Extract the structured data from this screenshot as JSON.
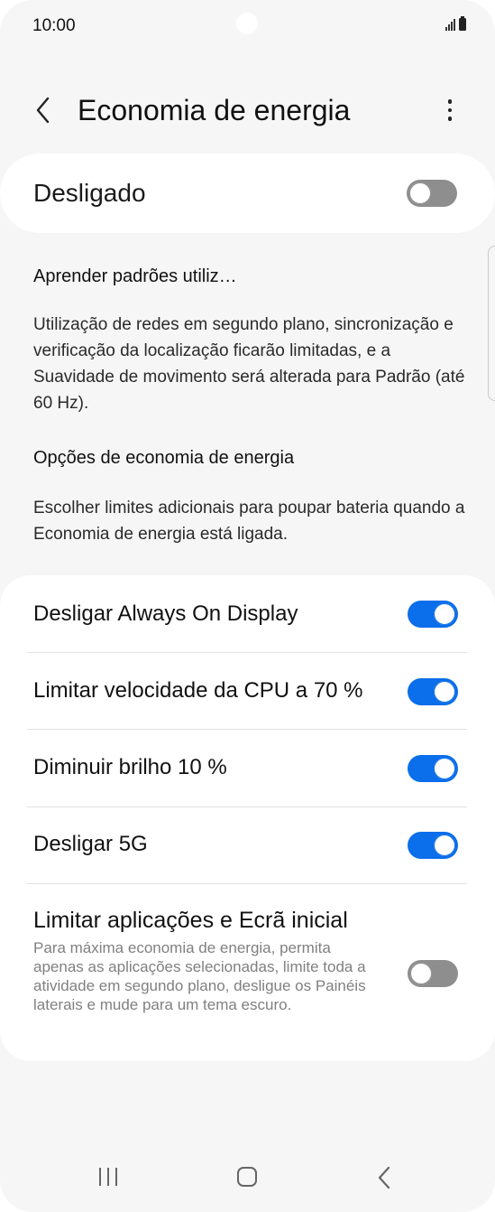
{
  "status_bar": {
    "time": "10:00",
    "icons": [
      "signal-icon",
      "battery-icon"
    ]
  },
  "header": {
    "title": "Economia de energia",
    "back_icon": "back-arrow-icon",
    "more_icon": "more-options-icon"
  },
  "master_switch": {
    "label": "Desligado",
    "state": "off"
  },
  "learn_section": {
    "title": "Aprender padrões utiliz…",
    "description": "Utilização de redes em segundo plano, sincronização e verificação da localização ficarão limitadas, e a Suavidade de movimento será alterada para Padrão (até 60 Hz)."
  },
  "options_section": {
    "title": "Opções de economia de energia",
    "description": "Escolher limites adicionais para poupar bateria quando a Economia de energia está ligada."
  },
  "options": [
    {
      "label": "Desligar Always On Display",
      "state": "on"
    },
    {
      "label": "Limitar velocidade da CPU a 70 %",
      "state": "on"
    },
    {
      "label": "Diminuir brilho 10 %",
      "state": "on"
    },
    {
      "label": "Desligar 5G",
      "state": "on"
    },
    {
      "label": "Limitar aplicações e Ecrã inicial",
      "state": "off",
      "subtitle": "Para máxima economia de energia, permita apenas as aplicações selecionadas, limite toda a atividade em segundo plano, desligue os Painéis laterais e mude para um tema escuro."
    }
  ],
  "colors": {
    "accent": "#0b6eea",
    "toggle_off": "#8e8e8e",
    "background": "#f6f6f6",
    "card": "#ffffff"
  },
  "nav_bar": {
    "icons": [
      "recent-apps-icon",
      "home-icon",
      "back-icon"
    ]
  }
}
